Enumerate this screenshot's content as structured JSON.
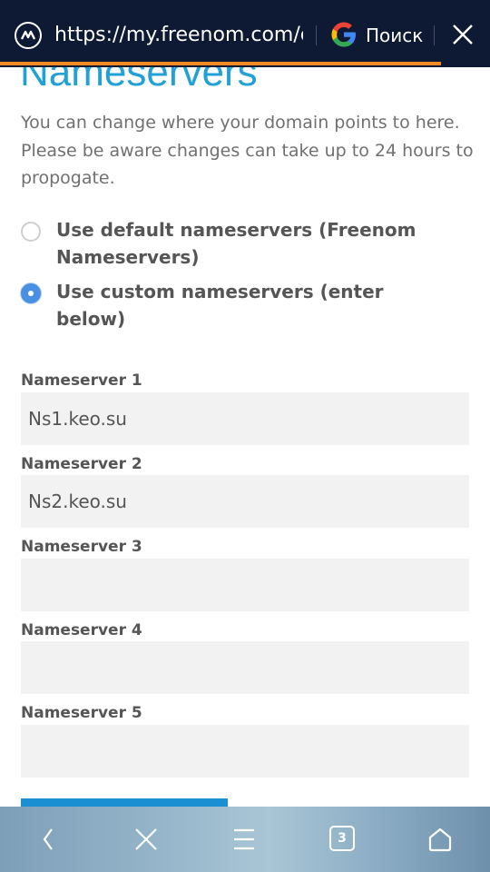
{
  "browser": {
    "url": "https://my.freenom.com/clientarea.php?managedns",
    "search_label": "Поиск",
    "accent_color": "#f28a23",
    "bar_color": "#0e1a33"
  },
  "page": {
    "heading": "Nameservers",
    "description": "You can change where your domain points to here. Please be aware changes can take up to 24 hours to propogate.",
    "options": [
      {
        "label": "Use default nameservers (Freenom Nameservers)",
        "selected": false
      },
      {
        "label": "Use custom nameservers (enter below)",
        "selected": true
      }
    ],
    "nameservers": [
      {
        "label": "Nameserver 1",
        "value": "Ns1.keo.su"
      },
      {
        "label": "Nameserver 2",
        "value": "Ns2.keo.su"
      },
      {
        "label": "Nameserver 3",
        "value": ""
      },
      {
        "label": "Nameserver 4",
        "value": ""
      },
      {
        "label": "Nameserver 5",
        "value": ""
      }
    ],
    "heading_color": "#21a1d6",
    "input_bg": "#f2f2f2"
  },
  "navbar": {
    "tab_count": "3",
    "icons": [
      "back-icon",
      "close-icon",
      "menu-icon",
      "tabs-icon",
      "home-icon"
    ]
  }
}
